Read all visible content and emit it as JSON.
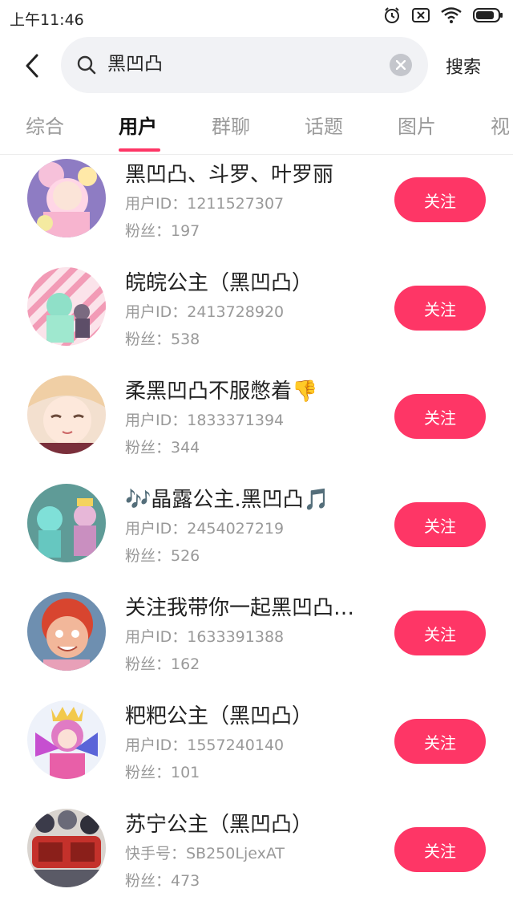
{
  "status_bar": {
    "time": "上午11:46",
    "icons": [
      "alarm-icon",
      "sim-off-icon",
      "wifi-icon",
      "battery-icon"
    ]
  },
  "header": {
    "search_query": "黑凹凸",
    "search_button": "搜索"
  },
  "tabs": [
    {
      "label": "综合",
      "active": false
    },
    {
      "label": "用户",
      "active": true
    },
    {
      "label": "群聊",
      "active": false
    },
    {
      "label": "话题",
      "active": false
    },
    {
      "label": "图片",
      "active": false
    },
    {
      "label": "视",
      "active": false
    }
  ],
  "users": [
    {
      "name": "黑凹凸、斗罗、叶罗丽",
      "id": "用户ID：1211527307",
      "fans": "粉丝：197",
      "follow": "关注"
    },
    {
      "name": "皖皖公主（黑凹凸）",
      "id": "用户ID：2413728920",
      "fans": "粉丝：538",
      "follow": "关注"
    },
    {
      "name": "柔黑凹凸不服憋着👎",
      "id": "用户ID：1833371394",
      "fans": "粉丝：344",
      "follow": "关注"
    },
    {
      "name": "🎶晶露公主.黑凹凸🎵",
      "id": "用户ID：2454027219",
      "fans": "粉丝：526",
      "follow": "关注"
    },
    {
      "name": "关注我带你一起黑凹凸…",
      "id": "用户ID：1633391388",
      "fans": "粉丝：162",
      "follow": "关注"
    },
    {
      "name": "粑粑公主（黑凹凸）",
      "id": "用户ID：1557240140",
      "fans": "粉丝：101",
      "follow": "关注"
    },
    {
      "name": "苏宁公主（黑凹凸）",
      "id": "快手号：SB250LjexAT",
      "fans": "粉丝：473",
      "follow": "关注"
    }
  ],
  "colors": {
    "accent": "#fe3666",
    "search_bg": "#f1f2f5",
    "secondary_text": "#999999"
  }
}
